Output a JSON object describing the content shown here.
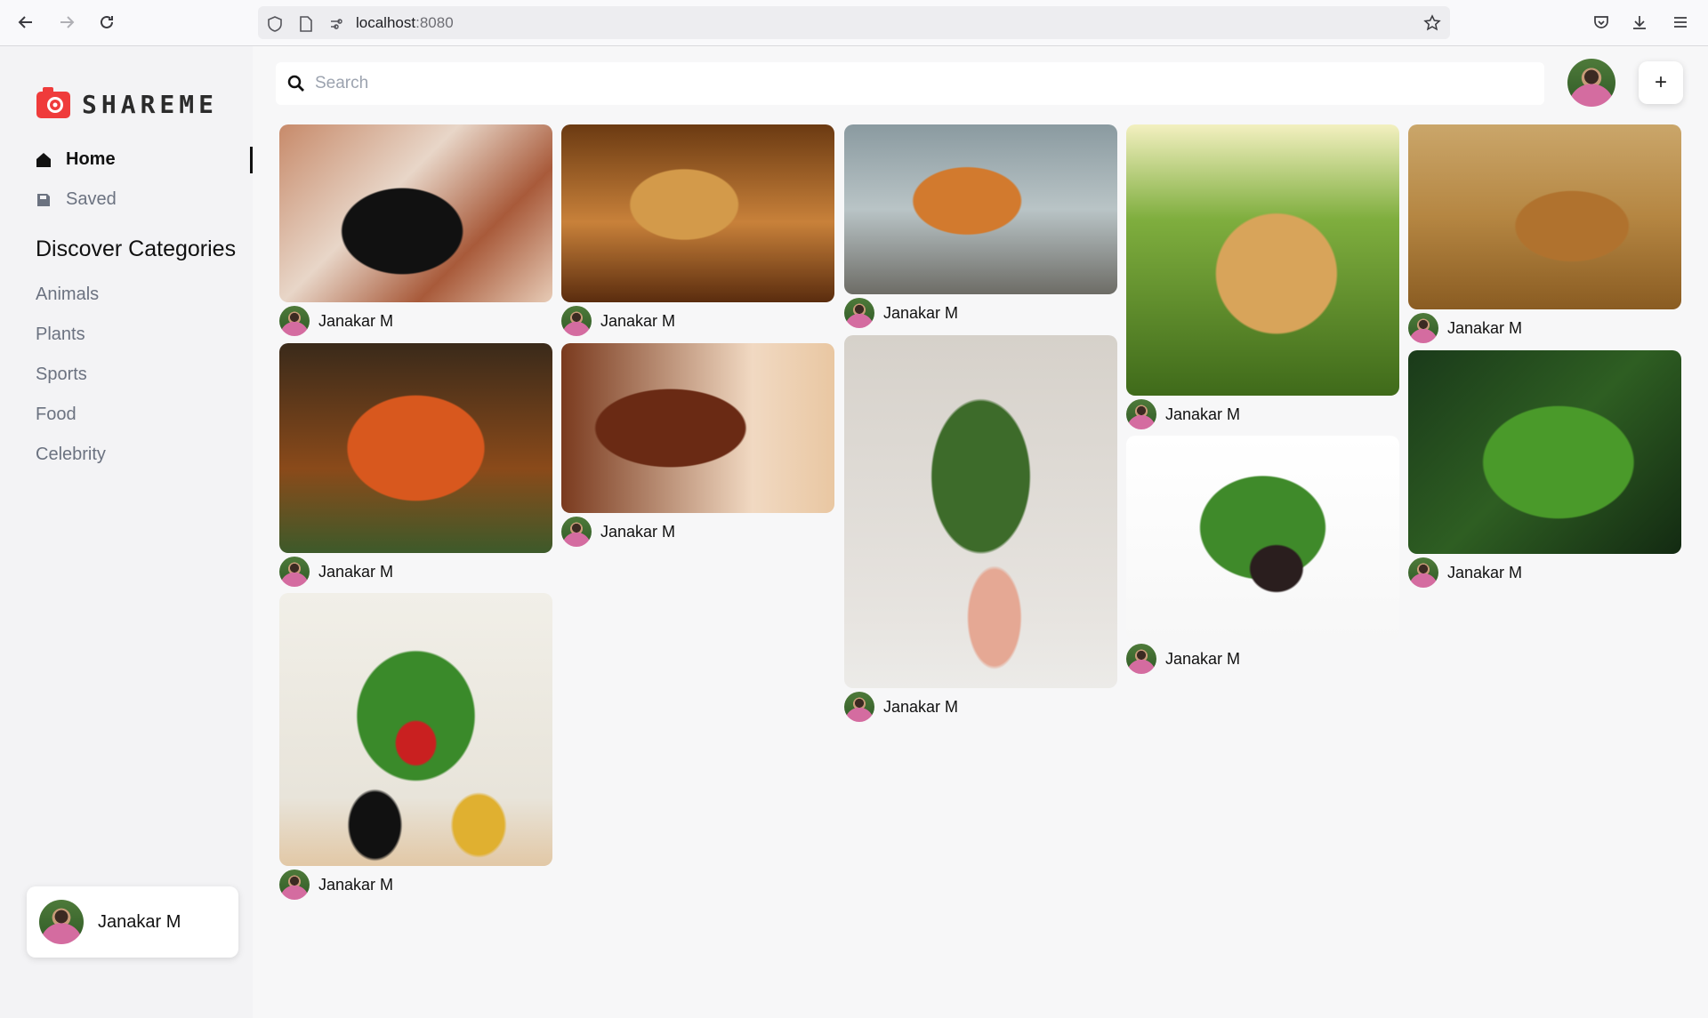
{
  "browser": {
    "url_host": "localhost",
    "url_port": ":8080"
  },
  "sidebar": {
    "logo_text": "SHAREME",
    "menu": [
      {
        "label": "Home",
        "active": true
      },
      {
        "label": "Saved",
        "active": false
      }
    ],
    "section_title": "Discover Categories",
    "categories": [
      "Animals",
      "Plants",
      "Sports",
      "Food",
      "Celebrity"
    ],
    "user": {
      "name": "Janakar M"
    }
  },
  "search": {
    "placeholder": "Search"
  },
  "add_button": {
    "label": "+"
  },
  "pins": [
    {
      "user": "Janakar M"
    },
    {
      "user": "Janakar M"
    },
    {
      "user": "Janakar M"
    },
    {
      "user": "Janakar M"
    },
    {
      "user": "Janakar M"
    },
    {
      "user": "Janakar M"
    },
    {
      "user": "Janakar M"
    },
    {
      "user": "Janakar M"
    },
    {
      "user": "Janakar M"
    },
    {
      "user": "Janakar M"
    },
    {
      "user": "Janakar M"
    }
  ]
}
